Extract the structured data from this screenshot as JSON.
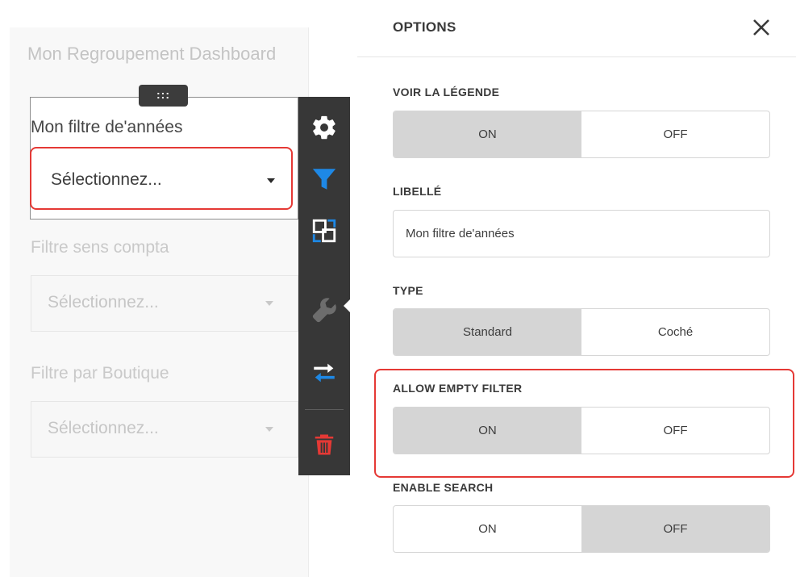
{
  "dashboard": {
    "title": "Mon Regroupement Dashboard",
    "drag_handle": ":::",
    "selected_item": {
      "caption": "Mon filtre de'années",
      "placeholder": "Sélectionnez..."
    },
    "filters": [
      {
        "label": "Filtre sens compta",
        "placeholder": "Sélectionnez..."
      },
      {
        "label": "Filtre par Boutique",
        "placeholder": "Sélectionnez..."
      }
    ]
  },
  "toolbar": {
    "items": [
      {
        "name": "settings",
        "icon": "gear-icon"
      },
      {
        "name": "filter",
        "icon": "filter-icon"
      },
      {
        "name": "convert",
        "icon": "convert-icon"
      },
      {
        "name": "options",
        "icon": "wrench-icon",
        "active": true
      },
      {
        "name": "interactivity",
        "icon": "arrows-icon"
      },
      {
        "name": "delete",
        "icon": "trash-icon"
      }
    ],
    "colors": {
      "background": "#373737",
      "accent_blue": "#1e88e5",
      "delete_red": "#e53935"
    }
  },
  "options_panel": {
    "title": "OPTIONS",
    "close_label": "✕",
    "show_legend": {
      "label": "VOIR LA LÉGENDE",
      "on": "ON",
      "off": "OFF",
      "selected": "ON"
    },
    "caption": {
      "label": "LIBELLÉ",
      "value": "Mon filtre de'années"
    },
    "type": {
      "label": "TYPE",
      "options": [
        "Standard",
        "Coché"
      ],
      "selected": "Standard"
    },
    "allow_empty_filter": {
      "label": "ALLOW EMPTY FILTER",
      "on": "ON",
      "off": "OFF",
      "selected": "ON"
    },
    "enable_search": {
      "label": "ENABLE SEARCH",
      "on": "ON",
      "off": "OFF",
      "selected": "OFF"
    }
  },
  "highlight_color": "#e53935"
}
